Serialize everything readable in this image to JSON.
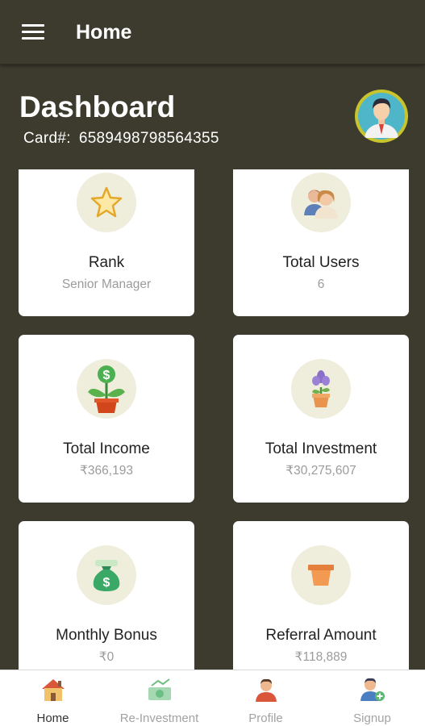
{
  "appbar": {
    "title": "Home"
  },
  "header": {
    "title": "Dashboard",
    "card_label": "Card#:",
    "card_number": "6589498798564355"
  },
  "cards": [
    {
      "label": "Rank",
      "value": "Senior Manager",
      "icon": "star-icon"
    },
    {
      "label": "Total Users",
      "value": "6",
      "icon": "users-icon"
    },
    {
      "label": "Total Income",
      "value": "₹366,193",
      "icon": "money-plant-icon"
    },
    {
      "label": "Total Investment",
      "value": "₹30,275,607",
      "icon": "flower-pot-icon"
    },
    {
      "label": "Monthly Bonus",
      "value": "₹0",
      "icon": "money-bag-icon"
    },
    {
      "label": "Referral Amount",
      "value": "₹118,889",
      "icon": "pot-icon"
    }
  ],
  "bottom_nav": [
    {
      "label": "Home",
      "icon": "home-icon",
      "active": true
    },
    {
      "label": "Re-Investment",
      "icon": "reinvestment-icon",
      "active": false
    },
    {
      "label": "Profile",
      "icon": "profile-icon",
      "active": false
    },
    {
      "label": "Signup",
      "icon": "signup-icon",
      "active": false
    }
  ],
  "colors": {
    "background": "#3d3b2e",
    "card": "#ffffff",
    "icon_circle": "#efeedd",
    "avatar_ring": "#c8c42d"
  }
}
